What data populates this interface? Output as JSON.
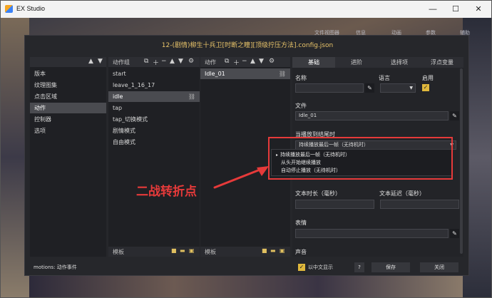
{
  "window": {
    "title": "EX Studio"
  },
  "background_tabs": [
    "文件视图器",
    "信息",
    "动画",
    "参数",
    "辅助"
  ],
  "dialog": {
    "title": "12-(剧情)柳生十兵卫[时断之瞳][顶级拧压方法].config.json",
    "left": {
      "items": [
        "版本",
        "纹理图集",
        "点击区域",
        "动作",
        "控制器",
        "选项"
      ],
      "selected_index": 3
    },
    "groups": {
      "header": "动作组",
      "items": [
        "start",
        "leave_1_16_17",
        "idle",
        "tap",
        "tap_切换模式",
        "剧情模式",
        "自由模式"
      ],
      "selected_index": 2,
      "footer": "模板"
    },
    "motions": {
      "header": "动作",
      "items": [
        "Idle_01"
      ],
      "selected_index": 0,
      "footer": "模板"
    },
    "right": {
      "tabs": [
        "基础",
        "进阶",
        "选择项",
        "浮点变量"
      ],
      "active_tab": 0,
      "labels": {
        "name": "名称",
        "language": "语言",
        "enable": "启用",
        "file": "文件",
        "on_finish": "当播放到结尾时",
        "text_duration": "文本时长（毫秒）",
        "text_delay": "文本延迟（毫秒）",
        "expression": "表情",
        "sound": "声音"
      },
      "values": {
        "name": "",
        "language": "",
        "file": "Idle_01",
        "on_finish": "持续播放最后一帧（无待机时）",
        "text_duration": "",
        "text_delay": "",
        "expression": ""
      },
      "enable_checked": true,
      "dropdown_options": [
        "持续播放最后一帧（无待机时）",
        "从头开始继续播放",
        "自动停止播放（无待机时）"
      ],
      "dropdown_selected": 0
    },
    "annotation": "二战转折点",
    "status": {
      "text": "motions: 动作事件",
      "chinese_display": "以中文显示",
      "help": "?",
      "save": "保存",
      "close": "关闭"
    }
  },
  "colors": {
    "accent": "#e9c46a",
    "annotation_red": "#e63a3a",
    "checkbox": "#e0b83c"
  }
}
